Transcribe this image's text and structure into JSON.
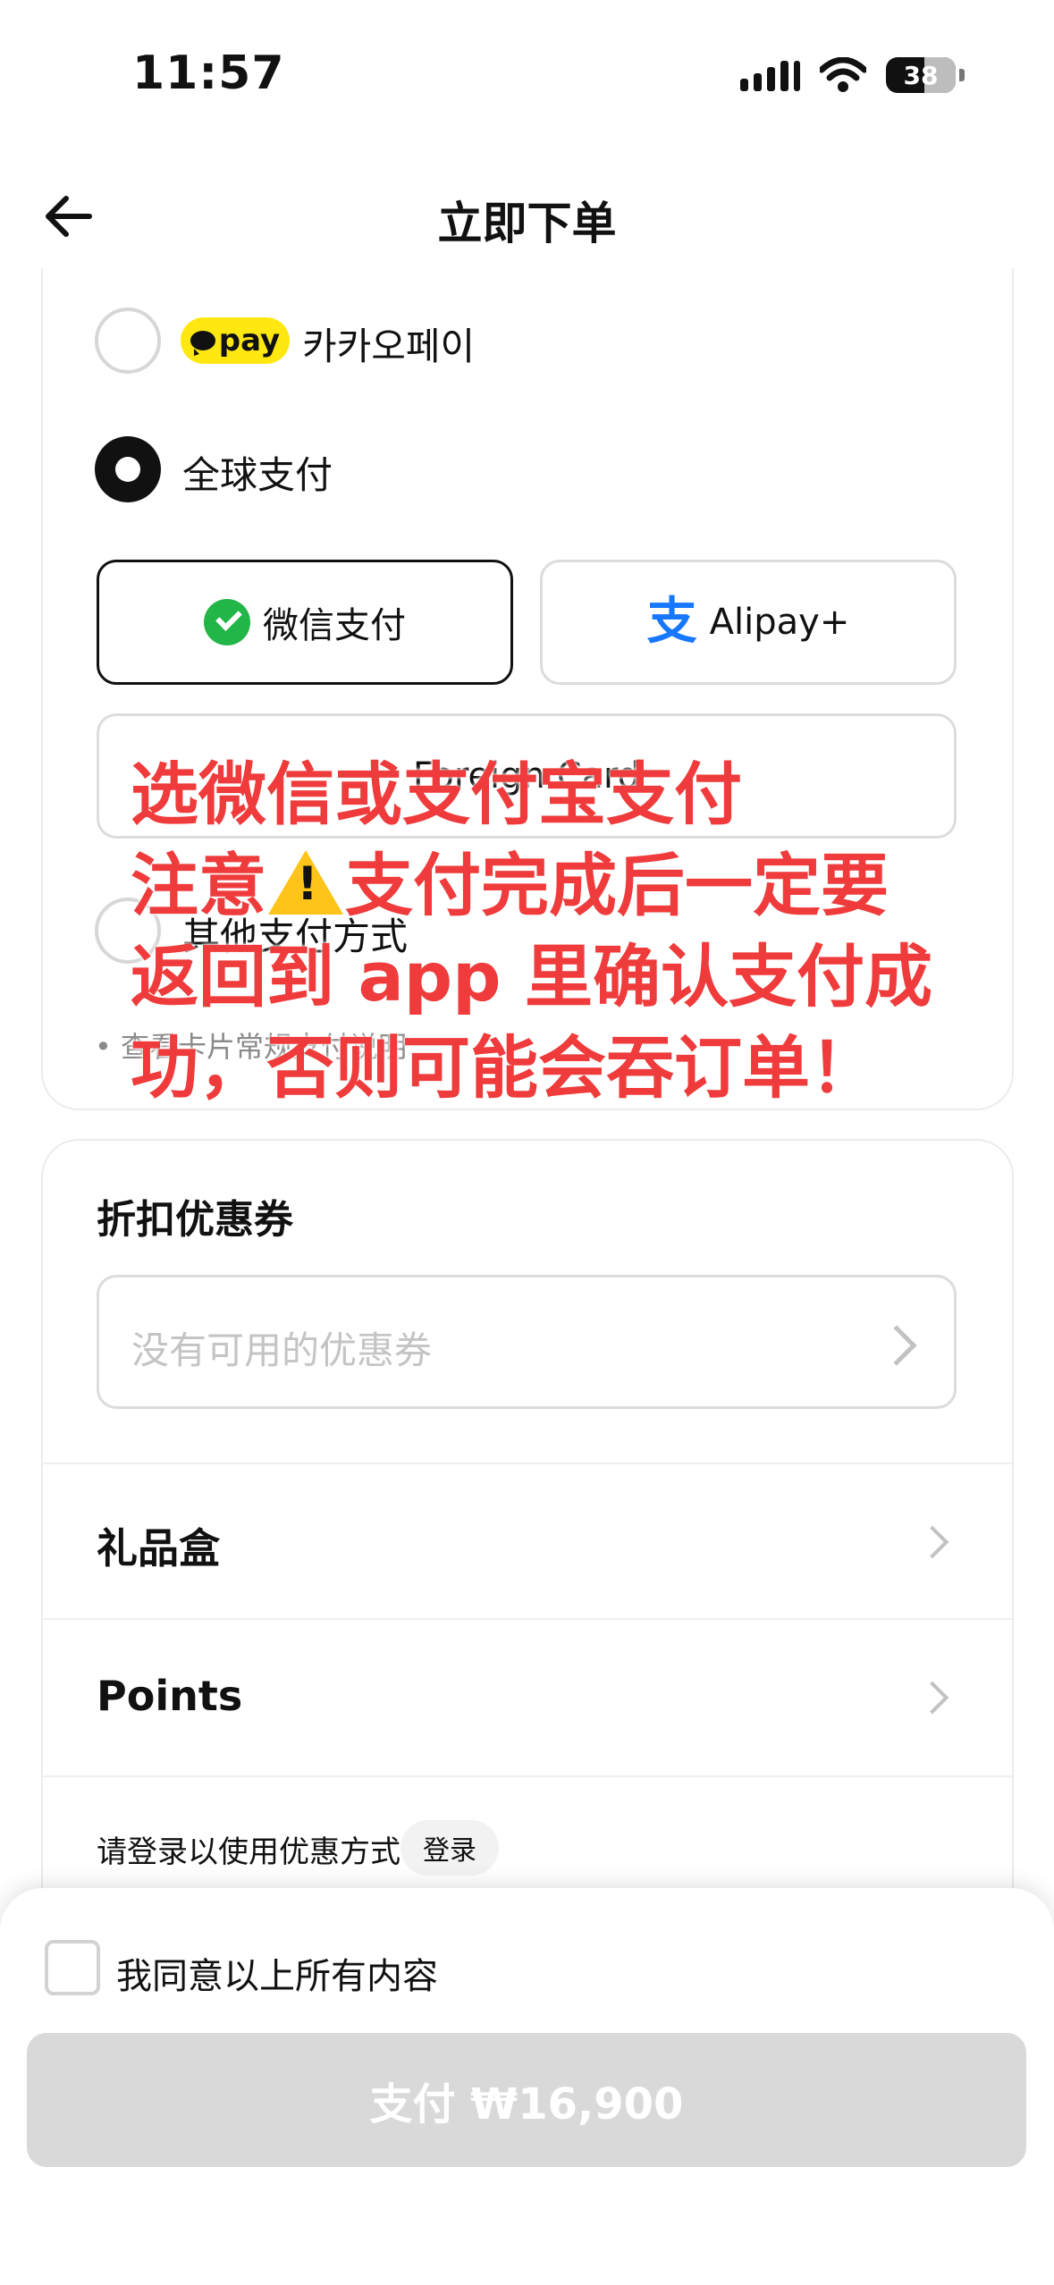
{
  "status_bar": {
    "time": "11:57",
    "battery": "38"
  },
  "header": {
    "title": "立即下单"
  },
  "payment": {
    "kakao_badge": "pay",
    "kakao_label": "카카오페이",
    "global_label": "全球支付",
    "wechat_label": "微信支付",
    "alipay_label": "Alipay+",
    "foreign_card_label": "Foreign Card",
    "other_label": "其他支付方式",
    "note": "• 查看卡片常规支付说明"
  },
  "overlay": {
    "line1": "选微信或支付宝支付",
    "line2_a": "注意",
    "line2_b": "支付完成后一定要",
    "line3": "返回到 app 里确认支付成",
    "line4": "功，否则可能会吞订单！"
  },
  "discount": {
    "title": "折扣优惠券",
    "coupon_placeholder": "没有可用的优惠券",
    "gift_box": "礼品盒",
    "points": "Points",
    "login_prompt": "请登录以使用优惠方式",
    "login_button": "登录"
  },
  "footer": {
    "agree_label": "我同意以上所有内容",
    "pay_button": "支付 ₩16,900"
  },
  "colors": {
    "accent": "#111111",
    "warning_text": "#ef3b3b",
    "kakao": "#ffe812",
    "wechat": "#22b548",
    "alipay": "#1677ff"
  }
}
